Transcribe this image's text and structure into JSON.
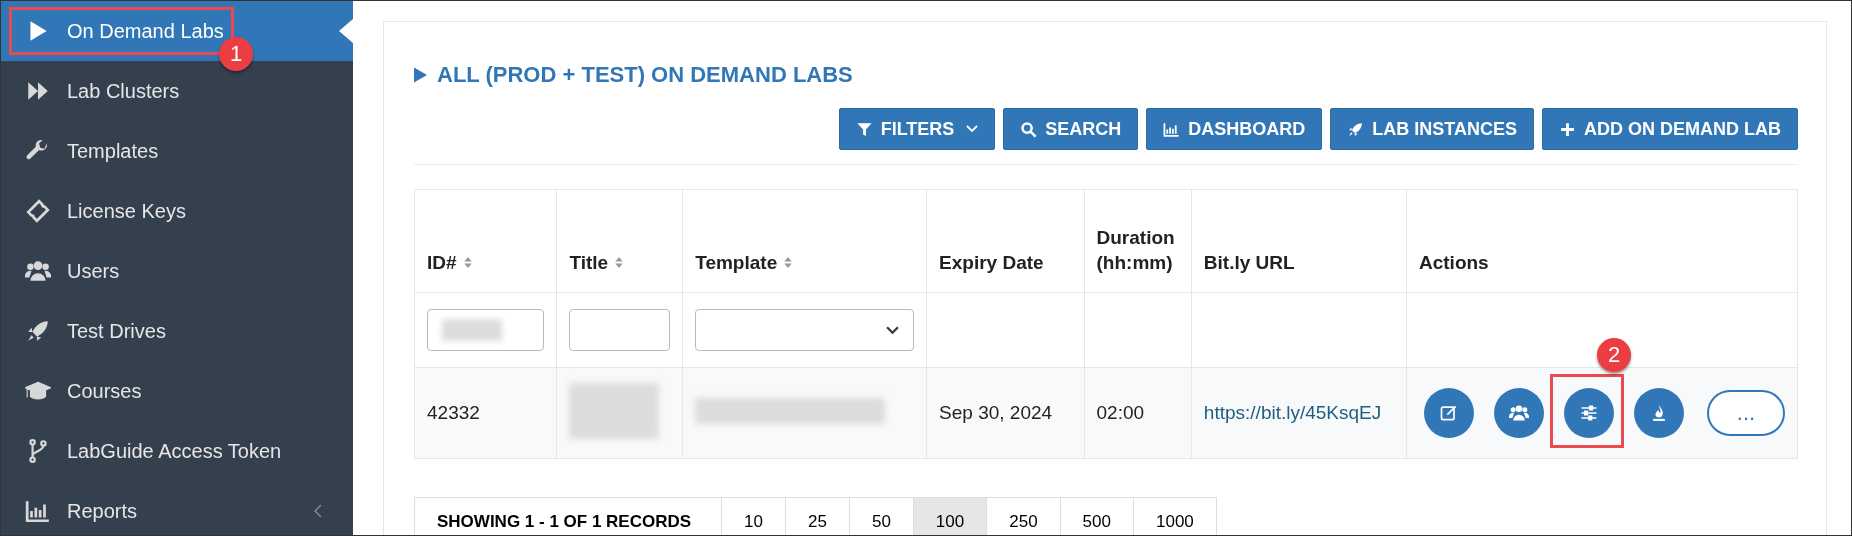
{
  "sidebar": {
    "items": [
      {
        "label": "On Demand Labs",
        "selected": true,
        "annotation": "1"
      },
      {
        "label": "Lab Clusters",
        "selected": false
      },
      {
        "label": "Templates",
        "selected": false
      },
      {
        "label": "License Keys",
        "selected": false
      },
      {
        "label": "Users",
        "selected": false
      },
      {
        "label": "Test Drives",
        "selected": false
      },
      {
        "label": "Courses",
        "selected": false
      },
      {
        "label": "LabGuide Access Token",
        "selected": false
      },
      {
        "label": "Reports",
        "selected": false,
        "expandable": true
      }
    ]
  },
  "page_title": "ALL (PROD + TEST) ON DEMAND LABS",
  "toolbar": [
    {
      "label": "FILTERS",
      "dropdown": true
    },
    {
      "label": "SEARCH"
    },
    {
      "label": "DASHBOARD"
    },
    {
      "label": "LAB INSTANCES"
    },
    {
      "label": "ADD ON DEMAND LAB"
    }
  ],
  "table": {
    "columns": [
      {
        "label": "ID#",
        "sortable": true
      },
      {
        "label": "Title",
        "sortable": true
      },
      {
        "label": "Template",
        "sortable": true
      },
      {
        "label": "Expiry Date",
        "sortable": false
      },
      {
        "label": "Duration (hh:mm)",
        "sortable": false
      },
      {
        "label": "Bit.ly URL",
        "sortable": false
      },
      {
        "label": "Actions",
        "sortable": false
      }
    ],
    "rows": [
      {
        "id": "42332",
        "expiry": "Sep 30, 2024",
        "duration": "02:00",
        "url": "https://bit.ly/45KsqEJ",
        "actions": [
          {
            "kind": "edit"
          },
          {
            "kind": "users"
          },
          {
            "kind": "settings",
            "annotation": "2"
          },
          {
            "kind": "fire"
          },
          {
            "kind": "more",
            "label": "..."
          }
        ]
      }
    ]
  },
  "pagination": {
    "summary": "SHOWING 1 - 1 OF 1 RECORDS",
    "sizes": [
      {
        "label": "10",
        "selected": false
      },
      {
        "label": "25",
        "selected": false
      },
      {
        "label": "50",
        "selected": false
      },
      {
        "label": "100",
        "selected": true
      },
      {
        "label": "250",
        "selected": false
      },
      {
        "label": "500",
        "selected": false
      },
      {
        "label": "1000",
        "selected": false
      }
    ]
  }
}
